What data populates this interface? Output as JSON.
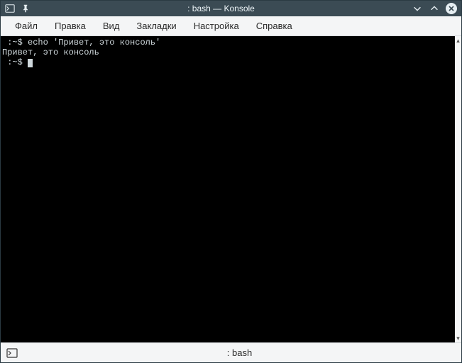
{
  "window": {
    "title": ": bash — Konsole"
  },
  "menu": {
    "items": [
      "Файл",
      "Правка",
      "Вид",
      "Закладки",
      "Настройка",
      "Справка"
    ]
  },
  "terminal": {
    "lines": [
      {
        "prompt": " :~$ ",
        "cmd": "echo 'Привет, это консоль'"
      },
      {
        "prompt": "",
        "cmd": "Привет, это консоль"
      },
      {
        "prompt": " :~$ ",
        "cmd": ""
      }
    ]
  },
  "status": {
    "tab_label": ": bash"
  }
}
